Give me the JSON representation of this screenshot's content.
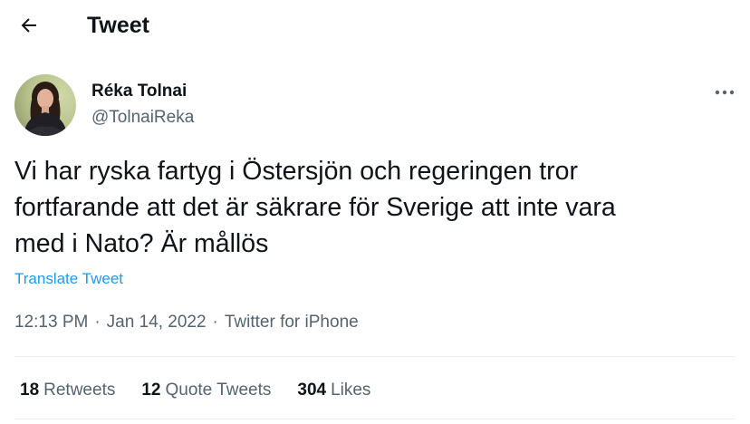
{
  "header": {
    "title": "Tweet",
    "back_icon": "arrow-left-icon"
  },
  "author": {
    "name": "Réka Tolnai",
    "handle": "@TolnaiReka",
    "more_icon": "more-horizontal-icon"
  },
  "tweet": {
    "text": "Vi har ryska fartyg i Östersjön och regeringen tror\nfortfarande att det är säkrare för Sverige att inte vara\nmed i Nato? Är mållös",
    "translate_label": "Translate Tweet",
    "time": "12:13 PM",
    "separator": "·",
    "date": "Jan 14, 2022",
    "source": "Twitter for iPhone"
  },
  "stats": {
    "retweets": {
      "count": "18",
      "label": "Retweets"
    },
    "quote_tweets": {
      "count": "12",
      "label": "Quote Tweets"
    },
    "likes": {
      "count": "304",
      "label": "Likes"
    }
  },
  "colors": {
    "accent": "#1d9bf0",
    "text": "#0f1419",
    "muted": "#536471",
    "divider": "#eff3f4"
  }
}
